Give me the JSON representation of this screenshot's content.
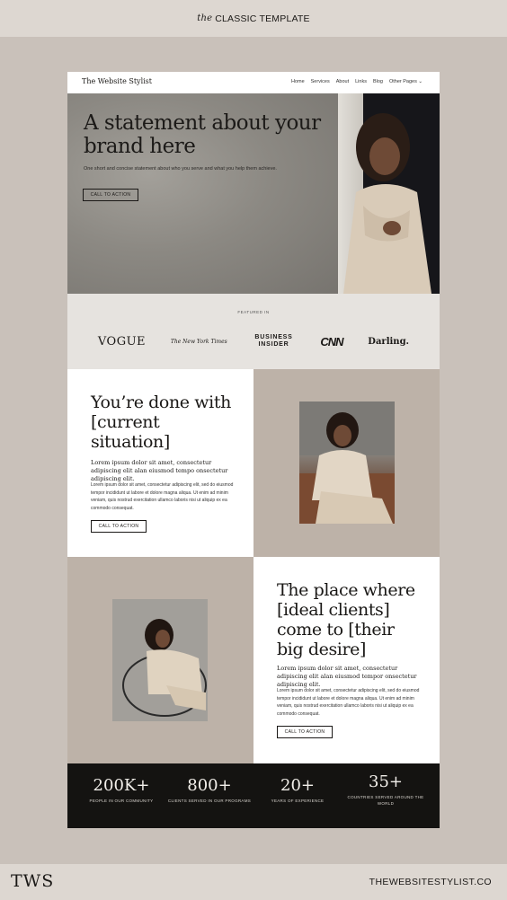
{
  "header": {
    "em": "the",
    "title": "CLASSIC TEMPLATE"
  },
  "footer": {
    "brand": "TWS",
    "site": "THEWEBSITESTYLIST.CO"
  },
  "nav": {
    "logo": "The Website Stylist",
    "items": [
      "Home",
      "Services",
      "About",
      "Links",
      "Blog",
      "Other Pages"
    ]
  },
  "hero": {
    "title": "A statement about your brand here",
    "subtitle": "One short and concise statement about who you serve and what you help them achieve.",
    "cta": "CALL TO ACTION"
  },
  "featured": {
    "label": "FEATURED IN",
    "logos": [
      "VOGUE",
      "The New York Times",
      "BUSINESS INSIDER",
      "CNN",
      "Darling."
    ]
  },
  "section2": {
    "title": "You’re done with [current situation]",
    "lead": "Lorem ipsum dolor sit amet, consectetur adipiscing elit alan eiusmod tempo onsectetur adipiscing elit.",
    "body": "Lorem ipsum dolor sit amet, consectetur adipiscing elit, sed do eiusmod tempor incididunt ut labore et dolore magna aliqua. Ut enim ad minim veniam, quis nostrud exercitation ullamco laboris nisi ut aliquip ex ea commodo consequat.",
    "cta": "CALL TO ACTION"
  },
  "section3": {
    "title": "The place where [ideal clients] come to [their big desire]",
    "lead": "Lorem ipsum dolor sit amet, consectetur adipiscing elit alan eiusmod tempor onsectetur adipiscing elit.",
    "body": "Lorem ipsum dolor sit amet, consectetur adipiscing elit, sed do eiusmod tempor incididunt ut labore et dolore magna aliqua. Ut enim ad minim veniam, quis nostrud exercitation ullamco laboris nisi ut aliquip ex ea commodo consequat.",
    "cta": "CALL TO ACTION"
  },
  "stats": [
    {
      "num": "200K+",
      "label": "PEOPLE IN OUR COMMUNITY"
    },
    {
      "num": "800+",
      "label": "CLIENTS SERVED IN OUR PROGRAMS"
    },
    {
      "num": "20+",
      "label": "YEARS OF EXPERIENCE"
    },
    {
      "num": "35+",
      "label": "COUNTRIES SERVED AROUND THE WORLD"
    }
  ],
  "colors": {
    "band": "#ddd7d1",
    "taupe": "#bdb2a8",
    "dark": "#141311",
    "featured_bg": "#e6e3df"
  }
}
